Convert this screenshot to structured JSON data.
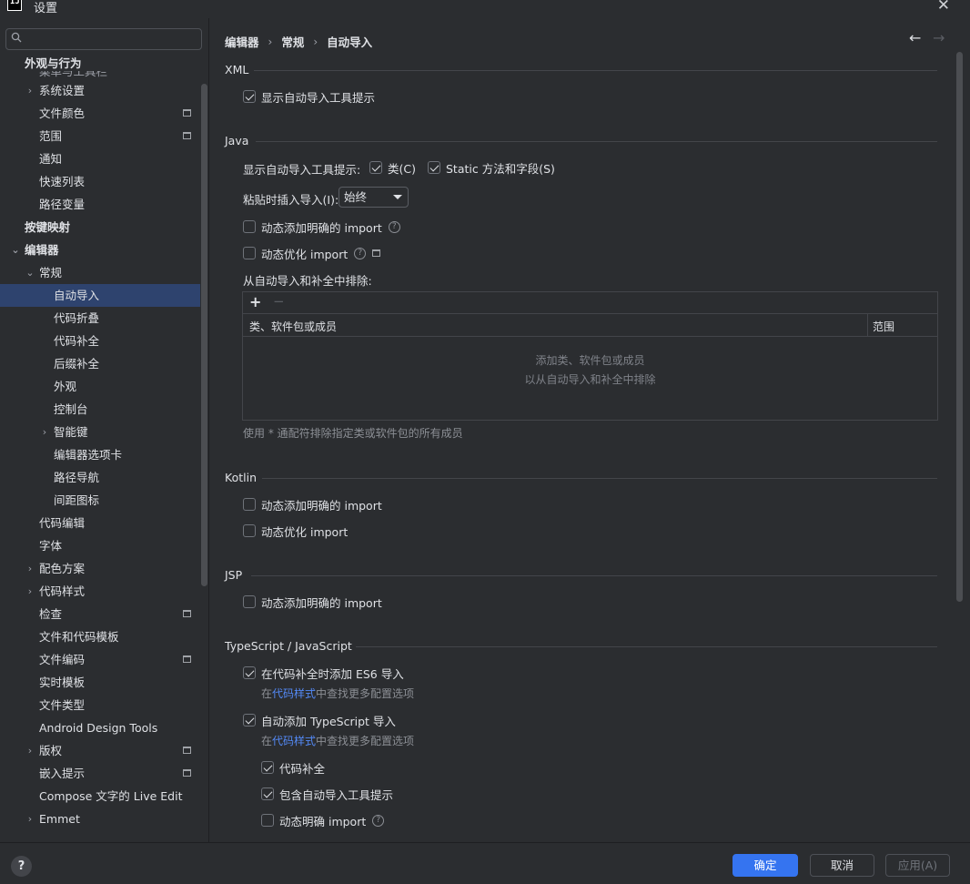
{
  "window": {
    "title": "设置",
    "logo": "IJ"
  },
  "search": {
    "placeholder": ""
  },
  "sidebar": {
    "group_appearance": "外观与行为",
    "partial_item": "菜单与工具栏",
    "items": [
      {
        "label": "系统设置",
        "indent": 1,
        "chevron": "›",
        "proj": false
      },
      {
        "label": "文件颜色",
        "indent": 1,
        "chevron": "",
        "proj": true
      },
      {
        "label": "范围",
        "indent": 1,
        "chevron": "",
        "proj": true
      },
      {
        "label": "通知",
        "indent": 1,
        "chevron": "",
        "proj": false
      },
      {
        "label": "快速列表",
        "indent": 1,
        "chevron": "",
        "proj": false
      },
      {
        "label": "路径变量",
        "indent": 1,
        "chevron": "",
        "proj": false
      },
      {
        "label": "按键映射",
        "indent": 0,
        "chevron": "",
        "proj": false,
        "bold": true
      },
      {
        "label": "编辑器",
        "indent": 0,
        "chevron": "⌄",
        "proj": false,
        "bold": true
      },
      {
        "label": "常规",
        "indent": 1,
        "chevron": "⌄",
        "proj": false
      },
      {
        "label": "自动导入",
        "indent": 2,
        "chevron": "",
        "proj": false,
        "selected": true
      },
      {
        "label": "代码折叠",
        "indent": 2,
        "chevron": "",
        "proj": false
      },
      {
        "label": "代码补全",
        "indent": 2,
        "chevron": "",
        "proj": false
      },
      {
        "label": "后缀补全",
        "indent": 2,
        "chevron": "",
        "proj": false
      },
      {
        "label": "外观",
        "indent": 2,
        "chevron": "",
        "proj": false
      },
      {
        "label": "控制台",
        "indent": 2,
        "chevron": "",
        "proj": false
      },
      {
        "label": "智能键",
        "indent": 2,
        "chevron": "›",
        "proj": false
      },
      {
        "label": "编辑器选项卡",
        "indent": 2,
        "chevron": "",
        "proj": false
      },
      {
        "label": "路径导航",
        "indent": 2,
        "chevron": "",
        "proj": false
      },
      {
        "label": "间距图标",
        "indent": 2,
        "chevron": "",
        "proj": false
      },
      {
        "label": "代码编辑",
        "indent": 1,
        "chevron": "",
        "proj": false
      },
      {
        "label": "字体",
        "indent": 1,
        "chevron": "",
        "proj": false
      },
      {
        "label": "配色方案",
        "indent": 1,
        "chevron": "›",
        "proj": false
      },
      {
        "label": "代码样式",
        "indent": 1,
        "chevron": "›",
        "proj": false
      },
      {
        "label": "检查",
        "indent": 1,
        "chevron": "",
        "proj": true
      },
      {
        "label": "文件和代码模板",
        "indent": 1,
        "chevron": "",
        "proj": false
      },
      {
        "label": "文件编码",
        "indent": 1,
        "chevron": "",
        "proj": true
      },
      {
        "label": "实时模板",
        "indent": 1,
        "chevron": "",
        "proj": false
      },
      {
        "label": "文件类型",
        "indent": 1,
        "chevron": "",
        "proj": false
      },
      {
        "label": "Android Design Tools",
        "indent": 1,
        "chevron": "",
        "proj": false
      },
      {
        "label": "版权",
        "indent": 1,
        "chevron": "›",
        "proj": true
      },
      {
        "label": "嵌入提示",
        "indent": 1,
        "chevron": "",
        "proj": true
      },
      {
        "label": "Compose 文字的 Live Edit",
        "indent": 1,
        "chevron": "",
        "proj": false
      },
      {
        "label": "Emmet",
        "indent": 1,
        "chevron": "›",
        "proj": false
      }
    ]
  },
  "breadcrumb": {
    "part1": "编辑器",
    "part2": "常规",
    "part3": "自动导入",
    "sep": "›"
  },
  "nav": {
    "back": "←",
    "forward": "→"
  },
  "xml": {
    "title": "XML",
    "show_popup": {
      "label": "显示自动导入工具提示",
      "checked": true
    }
  },
  "java": {
    "title": "Java",
    "show_popup_label": "显示自动导入工具提示:",
    "classes": {
      "label": "类(C)",
      "checked": true
    },
    "static": {
      "label": "Static 方法和字段(S)",
      "checked": true
    },
    "paste_label": "粘贴时插入导入(I):",
    "paste_value": "始终",
    "add_unambiguous": {
      "label": "动态添加明确的 import",
      "checked": false
    },
    "optimize": {
      "label": "动态优化 import",
      "checked": false
    },
    "exclude_label": "从自动导入和补全中排除:",
    "table": {
      "add": "+",
      "remove": "−",
      "col1": "类、软件包或成员",
      "col2": "范围",
      "empty1": "添加类、软件包或成员",
      "empty2": "以从自动导入和补全中排除"
    },
    "hint": "使用 * 通配符排除指定类或软件包的所有成员"
  },
  "kotlin": {
    "title": "Kotlin",
    "add_unambiguous": {
      "label": "动态添加明确的 import",
      "checked": false
    },
    "optimize": {
      "label": "动态优化 import",
      "checked": false
    }
  },
  "jsp": {
    "title": "JSP",
    "add_unambiguous": {
      "label": "动态添加明确的 import",
      "checked": false
    }
  },
  "ts": {
    "title": "TypeScript / JavaScript",
    "es6": {
      "label": "在代码补全时添加 ES6 导入",
      "checked": true
    },
    "more1_pre": "在",
    "more1_link": "代码样式",
    "more1_post": "中查找更多配置选项",
    "ts_import": {
      "label": "自动添加 TypeScript 导入",
      "checked": true
    },
    "more2_pre": "在",
    "more2_link": "代码样式",
    "more2_post": "中查找更多配置选项",
    "completion": {
      "label": "代码补全",
      "checked": true
    },
    "include_popup": {
      "label": "包含自动导入工具提示",
      "checked": true
    },
    "unambiguous": {
      "label": "动态明确 import",
      "checked": false
    }
  },
  "footer": {
    "help": "?",
    "ok": "确定",
    "cancel": "取消",
    "apply": "应用(A)"
  },
  "colors": {
    "accent": "#3574f0",
    "selection": "#2e436e",
    "link": "#548af7",
    "background": "#2b2d30"
  }
}
